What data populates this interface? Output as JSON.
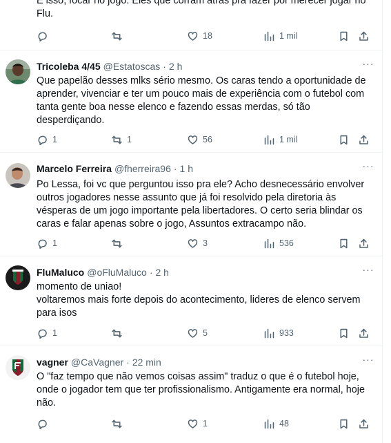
{
  "top_tweet": {
    "text": "É isso, focar no jogo. Eles que corram atrás pra fazer por merecer jogar no Flu.",
    "replies": "",
    "retweets": "",
    "likes": "18",
    "views": "1 mil"
  },
  "tweets": [
    {
      "name": "Tricoleba 4/45",
      "handle": "@Estatoscas",
      "dot": "·",
      "time": "2 h",
      "more": "···",
      "text": "Que papelão desses mlks sério mesmo. Os caras tendo a oportunidade de aprender, vivenciar e ter um pouco mais de experiência com o futebol com tanta gente boa nesse elenco e fazendo essas merdas, só tão desperdiçando.",
      "replies": "1",
      "retweets": "1",
      "likes": "56",
      "views": "1 mil"
    },
    {
      "name": "Marcelo Ferreira",
      "handle": "@fherreira96",
      "dot": "·",
      "time": "1 h",
      "more": "···",
      "text": "Po Lessa, foi vc que perguntou isso pra ele? Acho desnecessário envolver outros jogadores nesse assunto que já foi resolvido pela diretoria às vésperas de um jogo importante pela libertadores. O certo seria blindar os caras e falar apenas sobre o jogo, Assuntos extracampo não.",
      "replies": "1",
      "retweets": "",
      "likes": "3",
      "views": "536"
    },
    {
      "name": "FluMaluco",
      "handle": "@oFluMaluco",
      "dot": "·",
      "time": "2 h",
      "more": "···",
      "text": "momento de uniao!\nvoltaremos mais forte depois do acontecimento, lideres de elenco servem para isos",
      "replies": "1",
      "retweets": "",
      "likes": "5",
      "views": "933"
    },
    {
      "name": "vagner",
      "handle": "@CaVagner",
      "dot": "·",
      "time": "22 min",
      "more": "···",
      "text": "O \"faz tempo que não vemos coisas assim\" traduz o que é o futebol hoje, onde o jogador tem que ter profissionalismo. Antigamente era normal, hoje não.",
      "replies": "",
      "retweets": "",
      "likes": "1",
      "views": "48"
    }
  ],
  "icons": {
    "reply": "reply-icon",
    "retweet": "retweet-icon",
    "like": "heart-icon",
    "views": "views-icon",
    "bookmark": "bookmark-icon",
    "share": "share-icon"
  },
  "colors": {
    "text": "#0f1419",
    "secondary": "#536471",
    "divider": "#eff3f4",
    "flu_red": "#8c1b2a",
    "flu_green": "#0b6b3a"
  }
}
